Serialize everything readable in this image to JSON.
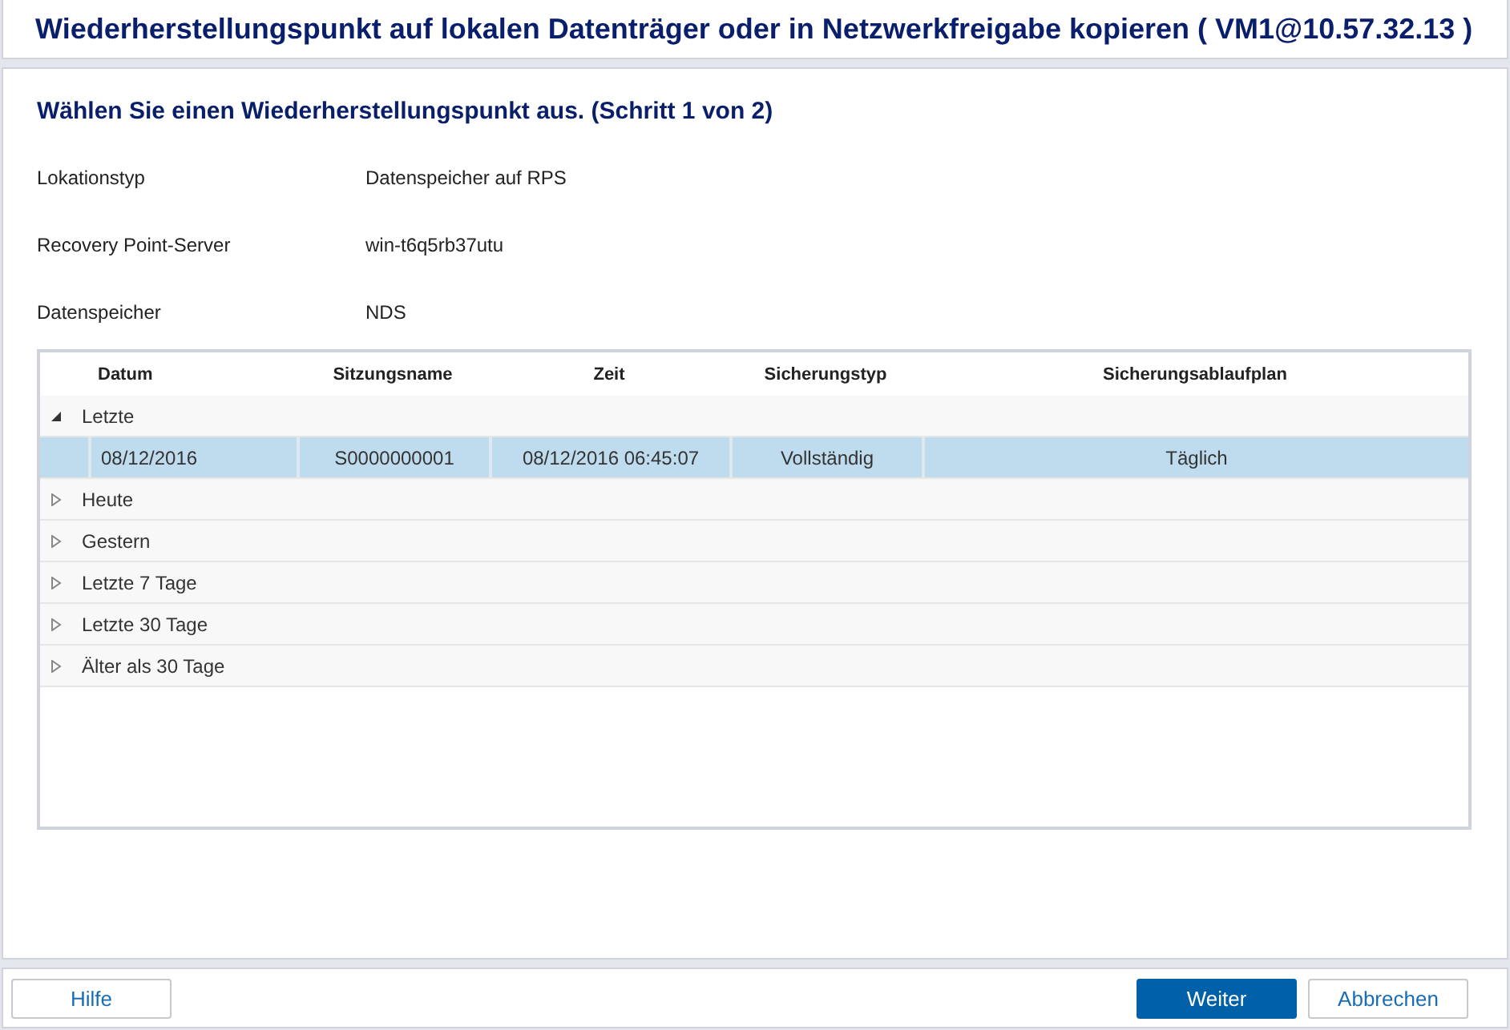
{
  "window": {
    "title": "Wiederherstellungspunkt auf lokalen Datenträger oder in Netzwerkfreigabe kopieren ( VM1@10.57.32.13 )"
  },
  "step_title": "Wählen Sie einen Wiederherstellungspunkt aus. (Schritt 1 von 2)",
  "fields": [
    {
      "label": "Lokationstyp",
      "value": "Datenspeicher auf RPS"
    },
    {
      "label": "Recovery Point-Server",
      "value": "win-t6q5rb37utu"
    },
    {
      "label": "Datenspeicher",
      "value": "NDS"
    }
  ],
  "table": {
    "columns": [
      "Datum",
      "Sitzungsname",
      "Zeit",
      "Sicherungstyp",
      "Sicherungsablaufplan"
    ],
    "groups": [
      {
        "label": "Letzte",
        "expanded": true,
        "rows": [
          {
            "cells": [
              "08/12/2016",
              "S0000000001",
              "08/12/2016 06:45:07",
              "Vollständig",
              "Täglich"
            ],
            "selected": true
          }
        ]
      },
      {
        "label": "Heute",
        "expanded": false
      },
      {
        "label": "Gestern",
        "expanded": false
      },
      {
        "label": "Letzte 7 Tage",
        "expanded": false
      },
      {
        "label": "Letzte 30 Tage",
        "expanded": false
      },
      {
        "label": "Älter als 30 Tage",
        "expanded": false
      }
    ]
  },
  "buttons": [
    {
      "label": "Hilfe",
      "kind": "default"
    },
    {
      "label": "Weiter",
      "kind": "primary"
    },
    {
      "label": "Abbrechen",
      "kind": "default"
    }
  ]
}
